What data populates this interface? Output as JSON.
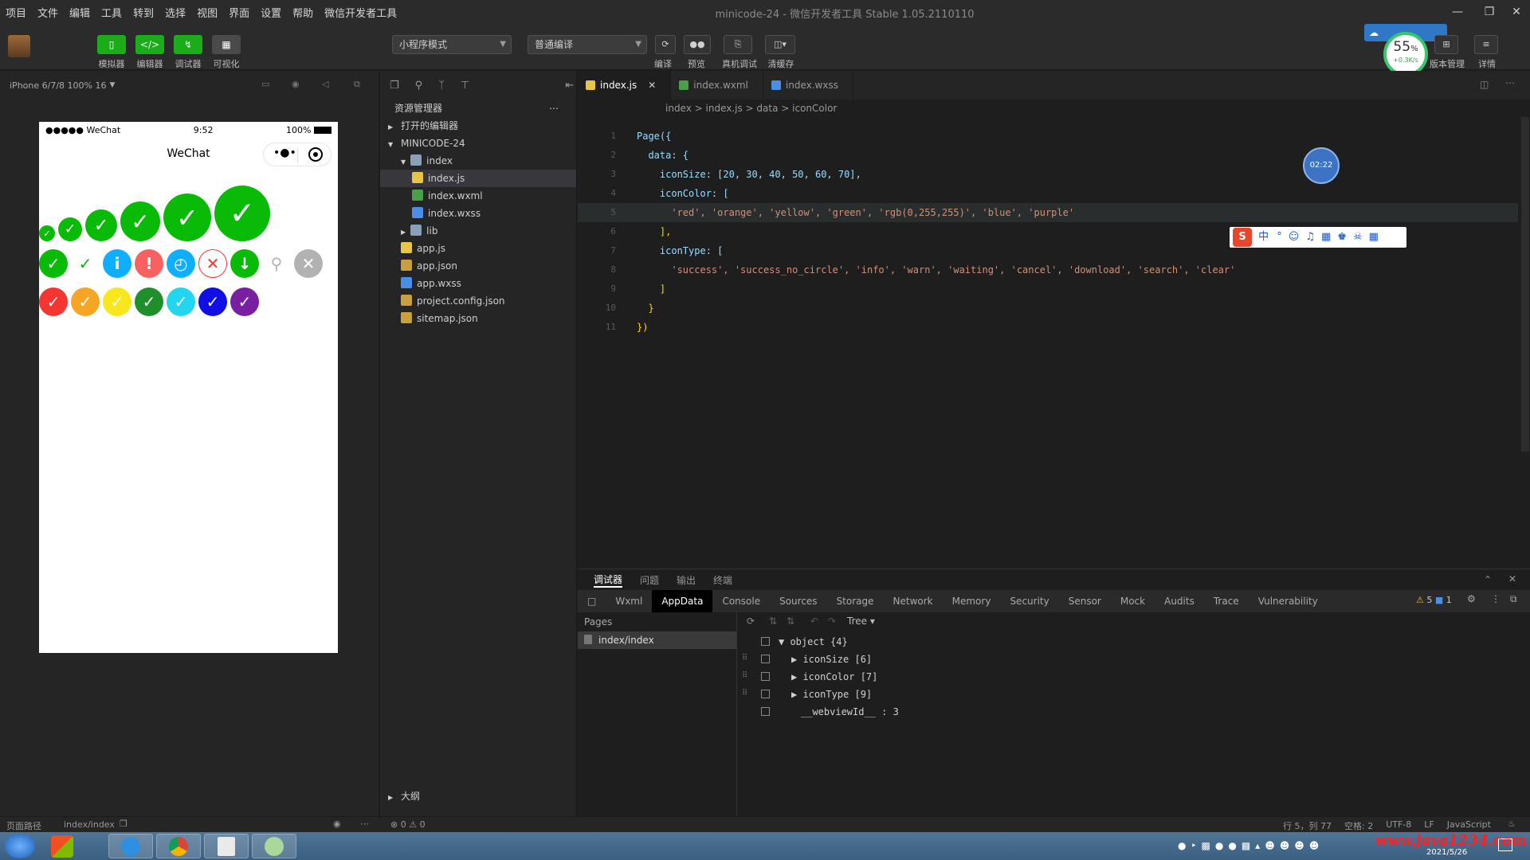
{
  "menubar": {
    "items": [
      "项目",
      "文件",
      "编辑",
      "工具",
      "转到",
      "选择",
      "视图",
      "界面",
      "设置",
      "帮助",
      "微信开发者工具"
    ],
    "title": "minicode-24 - 微信开发者工具 Stable 1.05.2110110"
  },
  "toolbar": {
    "buttons": [
      {
        "label": "模拟器",
        "icon": "phone-icon"
      },
      {
        "label": "编辑器",
        "icon": "code-icon"
      },
      {
        "label": "调试器",
        "icon": "debug-icon"
      },
      {
        "label": "可视化",
        "icon": "layout-icon"
      }
    ],
    "mode_select": "小程序模式",
    "compile_select": "普通编译",
    "right_labels": [
      "编译",
      "预览",
      "真机调试",
      "清缓存"
    ],
    "version_labels": [
      "版本管理",
      "详情"
    ],
    "perf_value": "55",
    "perf_unit": "%",
    "perf_sub": "+0.3K/s",
    "compile_btn": "切后台"
  },
  "simulator": {
    "header": "iPhone 6/7/8 100% 16",
    "phone": {
      "carrier": "●●●●● WeChat",
      "time": "9:52",
      "battery": "100%",
      "nav_title": "WeChat"
    },
    "icon_rows": {
      "sizes": [
        20,
        30,
        40,
        50,
        60,
        70
      ],
      "types": [
        "success",
        "success_no_circle",
        "info",
        "warn",
        "waiting",
        "cancel",
        "download",
        "search",
        "clear"
      ],
      "colors": [
        "red",
        "orange",
        "yellow",
        "green",
        "rgb(0,255,255)",
        "blue",
        "purple"
      ]
    }
  },
  "explorer": {
    "title": "资源管理器",
    "open_editors": "打开的编辑器",
    "project": "MINICODE-24",
    "outline": "大纲",
    "tree": [
      {
        "name": "index",
        "type": "folder",
        "level": 1
      },
      {
        "name": "index.js",
        "type": "js",
        "level": 2,
        "selected": true
      },
      {
        "name": "index.wxml",
        "type": "wxml",
        "level": 2
      },
      {
        "name": "index.wxss",
        "type": "wxss",
        "level": 2
      },
      {
        "name": "lib",
        "type": "folder",
        "level": 1
      },
      {
        "name": "app.js",
        "type": "js",
        "level": 1
      },
      {
        "name": "app.json",
        "type": "json",
        "level": 1
      },
      {
        "name": "app.wxss",
        "type": "wxss",
        "level": 1
      },
      {
        "name": "project.config.json",
        "type": "json",
        "level": 1
      },
      {
        "name": "sitemap.json",
        "type": "json",
        "level": 1
      }
    ]
  },
  "editor": {
    "tabs": [
      {
        "label": "index.js",
        "active": true
      },
      {
        "label": "index.wxml",
        "active": false
      },
      {
        "label": "index.wxss",
        "active": false
      }
    ],
    "breadcrumb": "index > index.js > data > iconColor",
    "lines": [
      {
        "num": "1",
        "text": "Page({"
      },
      {
        "num": "2",
        "text": "  data: {"
      },
      {
        "num": "3",
        "text": "    iconSize: [20, 30, 40, 50, 60, 70],"
      },
      {
        "num": "4",
        "text": "    iconColor: ["
      },
      {
        "num": "5",
        "text": "      'red', 'orange', 'yellow', 'green', 'rgb(0,255,255)', 'blue', 'purple'"
      },
      {
        "num": "6",
        "text": "    ],"
      },
      {
        "num": "7",
        "text": "    iconType: ["
      },
      {
        "num": "8",
        "text": "      'success', 'success_no_circle', 'info', 'warn', 'waiting', 'cancel', 'download', 'search', 'clear'"
      },
      {
        "num": "9",
        "text": "    ]"
      },
      {
        "num": "10",
        "text": "  }"
      },
      {
        "num": "11",
        "text": "})"
      }
    ],
    "timer_badge": "02:22",
    "ime_label": "中"
  },
  "devtools": {
    "top_tabs": [
      "调试器",
      "问题",
      "输出",
      "终端"
    ],
    "tabs": [
      "Wxml",
      "AppData",
      "Console",
      "Sources",
      "Storage",
      "Network",
      "Memory",
      "Security",
      "Sensor",
      "Mock",
      "Audits",
      "Trace",
      "Vulnerability"
    ],
    "active_tab": "AppData",
    "warn_count": "5",
    "info_count": "1",
    "pages_label": "Pages",
    "page_path": "index/index",
    "view_mode": "Tree",
    "object_rows": [
      "▼ object {4}",
      "▶ iconSize [6]",
      "▶ iconColor [7]",
      "▶ iconType [9]",
      "__webviewId__ : 3"
    ]
  },
  "statusbar": {
    "left": "页面路径",
    "path": "index/index",
    "errors": "⊗ 0 ⚠ 0",
    "right": [
      "行 5，列 77",
      "空格: 2",
      "UTF-8",
      "LF",
      "JavaScript"
    ]
  },
  "taskbar": {
    "watermark": "www.java1234.com",
    "date": "2021/5/26"
  }
}
